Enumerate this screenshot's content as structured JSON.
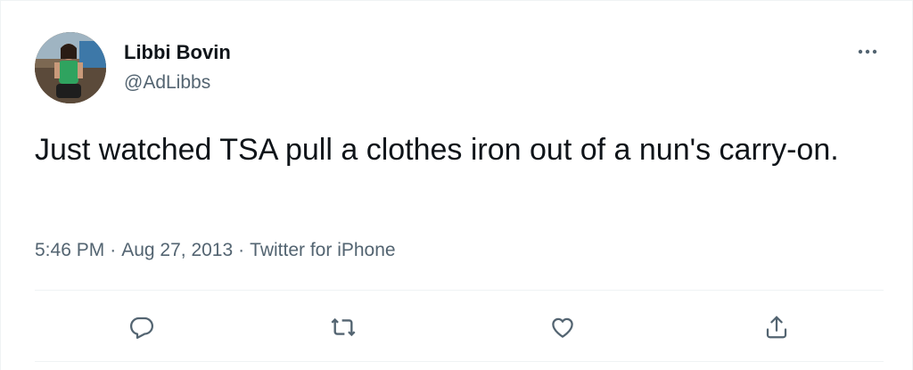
{
  "tweet": {
    "author": {
      "display_name": "Libbi Bovin",
      "handle": "@AdLibbs"
    },
    "text": "Just watched TSA pull a clothes iron out of a nun's carry-on.",
    "time": "5:46 PM",
    "separator": "·",
    "date": "Aug 27, 2013",
    "source": "Twitter for iPhone"
  },
  "actions": [
    {
      "icon": "reply-icon"
    },
    {
      "icon": "retweet-icon"
    },
    {
      "icon": "like-icon"
    },
    {
      "icon": "share-icon"
    }
  ],
  "colors": {
    "text_primary": "#0f1419",
    "text_secondary": "#536471",
    "divider": "#eff3f4"
  }
}
